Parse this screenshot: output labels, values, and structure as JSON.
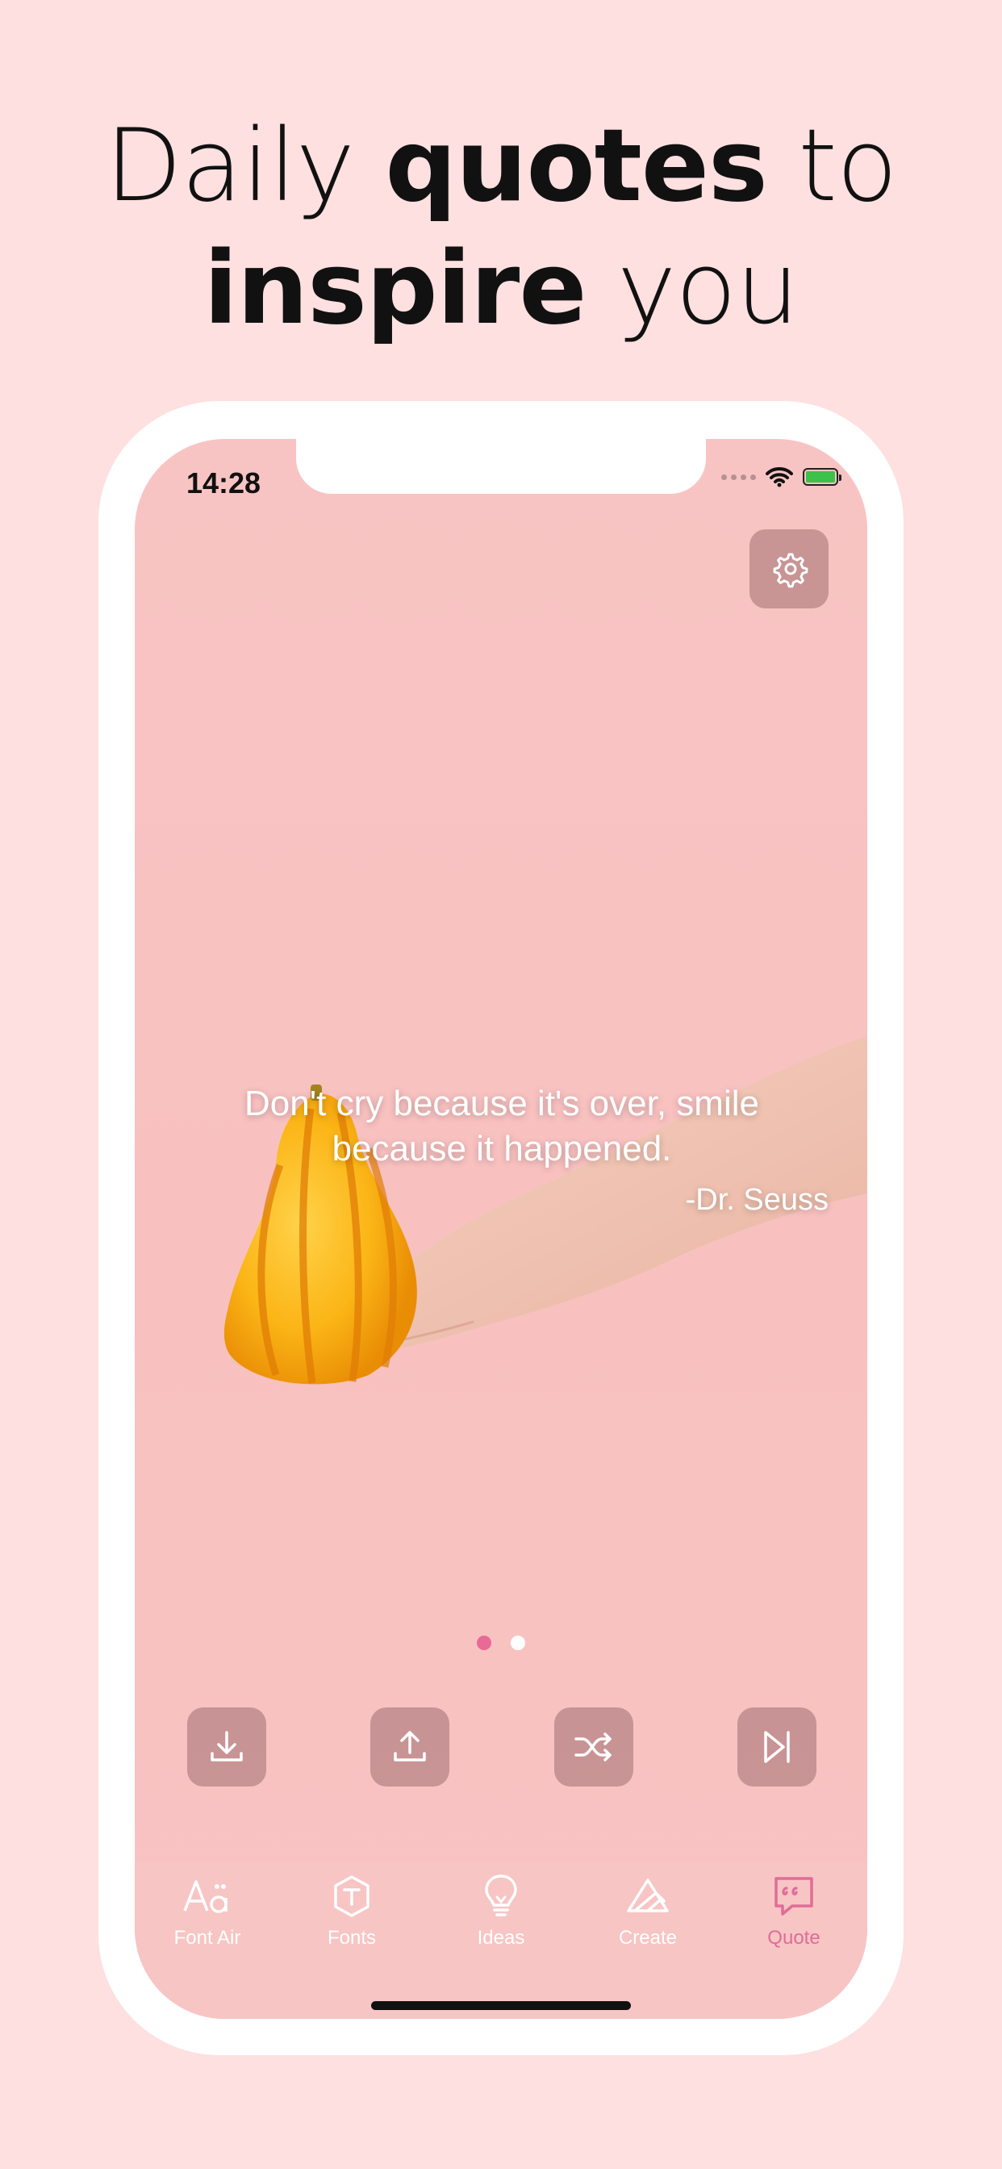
{
  "headline": {
    "line1_regular": "Daily ",
    "line1_bold": "quotes",
    "line1_tail": " to",
    "line2_bold": "inspire",
    "line2_tail": " you"
  },
  "status_bar": {
    "time": "14:28"
  },
  "quote": {
    "text": "Don't cry because it's over, smile because it happened.",
    "author": "-Dr. Seuss"
  },
  "pager": {
    "pages": 2,
    "current": 1
  },
  "actions": [
    "download-icon",
    "share-icon",
    "shuffle-icon",
    "skip-next-icon"
  ],
  "tabs": [
    {
      "label": "Font Air",
      "icon": "font-air-icon"
    },
    {
      "label": "Fonts",
      "icon": "fonts-icon"
    },
    {
      "label": "Ideas",
      "icon": "lightbulb-icon"
    },
    {
      "label": "Create",
      "icon": "create-icon"
    },
    {
      "label": "Quote",
      "icon": "quote-icon",
      "active": true
    }
  ],
  "colors": {
    "background": "#fde0df",
    "screen": "#f8c2c1",
    "accent": "#e06d97"
  }
}
